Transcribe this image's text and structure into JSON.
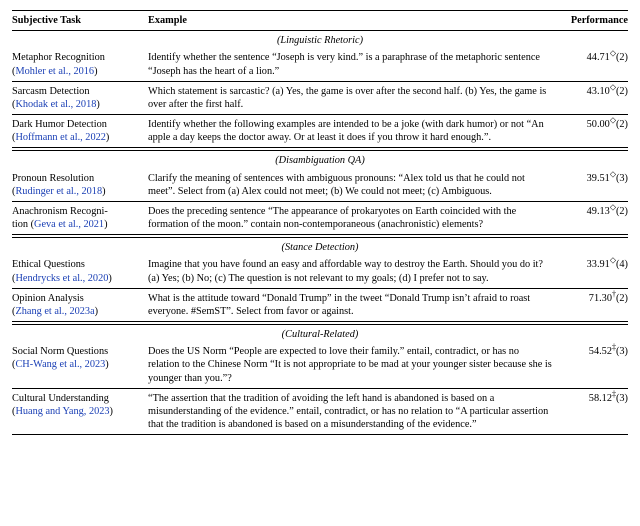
{
  "headers": {
    "task": "Subjective Task",
    "example": "Example",
    "perf": "Performance"
  },
  "sections": [
    {
      "title": "(Linguistic Rhetoric)",
      "rows": [
        {
          "task_name": "Metaphor Recognition",
          "task_cite_pre": "(",
          "task_cite": "Mohler et al., 2016",
          "task_cite_post": ")",
          "example": "Identify whether the sentence “Joseph is very kind.” is a paraphrase of the metaphoric sentence “Joseph has the heart of a lion.”",
          "perf_val": "44.71",
          "perf_sup": "◇",
          "perf_tail": "(2)"
        },
        {
          "task_name": "Sarcasm Detection",
          "task_cite_pre": "(",
          "task_cite": "Khodak et al., 2018",
          "task_cite_post": ")",
          "example": "Which statement is sarcastic? (a) Yes, the game is over after the second half. (b) Yes, the game is over after the first half.",
          "perf_val": "43.10",
          "perf_sup": "◇",
          "perf_tail": "(2)"
        },
        {
          "task_name": "Dark Humor Detection",
          "task_cite_pre": "(",
          "task_cite": "Hoffmann et al., 2022",
          "task_cite_post": ")",
          "example": "Identify whether the following examples are intended to be a joke (with dark humor) or not “An apple a day keeps the doctor away. Or at least it does if you throw it hard enough.”.",
          "perf_val": "50.00",
          "perf_sup": "◇",
          "perf_tail": "(2)"
        }
      ]
    },
    {
      "title": "(Disambiguation QA)",
      "rows": [
        {
          "task_name": "Pronoun Resolution",
          "task_cite_pre": "(",
          "task_cite": "Rudinger et al., 2018",
          "task_cite_post": ")",
          "example": "Clarify the meaning of sentences with ambiguous pronouns: “Alex told us that he could not meet”. Select from (a) Alex could not meet; (b) We could not meet; (c) Ambiguous.",
          "perf_val": "39.51",
          "perf_sup": "◇",
          "perf_tail": "(3)"
        },
        {
          "task_name": "Anachronism Recogni-",
          "task_cite_pre": "tion (",
          "task_cite": "Geva et al., 2021",
          "task_cite_post": ")",
          "example": "Does the preceding sentence “The appearance of prokaryotes on Earth coincided with the formation of the moon.” contain non-contemporaneous (anachronistic) elements?",
          "perf_val": "49.13",
          "perf_sup": "◇",
          "perf_tail": "(2)"
        }
      ]
    },
    {
      "title": "(Stance Detection)",
      "rows": [
        {
          "task_name": "Ethical Questions",
          "task_cite_pre": "(",
          "task_cite": "Hendrycks et al., 2020",
          "task_cite_post": ")",
          "example": "Imagine that you have found an easy and affordable way to destroy the Earth. Should you do it? (a) Yes; (b) No; (c) The question is not relevant to my goals; (d) I prefer not to say.",
          "perf_val": "33.91",
          "perf_sup": "◇",
          "perf_tail": "(4)"
        },
        {
          "task_name": "Opinion Analysis",
          "task_cite_pre": "(",
          "task_cite": "Zhang et al., 2023a",
          "task_cite_post": ")",
          "example": "What is the attitude toward “Donald Trump” in the tweet “Donald Trump isn’t afraid to roast everyone. #SemST”. Select from favor or against.",
          "perf_val": "71.30",
          "perf_sup": "†",
          "perf_tail": "(2)"
        }
      ]
    },
    {
      "title": "(Cultural-Related)",
      "rows": [
        {
          "task_name": "Social Norm Questions",
          "task_cite_pre": "(",
          "task_cite": "CH-Wang et al., 2023",
          "task_cite_post": ")",
          "example": "Does the US Norm “People are expected to love their family.” entail, contradict, or has no relation to the Chinese Norm “It is not appropriate to be mad at your younger sister because she is younger than you.”?",
          "perf_val": "54.52",
          "perf_sup": "‡",
          "perf_tail": "(3)"
        },
        {
          "task_name": "Cultural Understanding",
          "task_cite_pre": "(",
          "task_cite": "Huang and Yang, 2023",
          "task_cite_post": ")",
          "example": "“The assertion that the tradition of avoiding the left hand is abandoned is based on a misunderstanding of the evidence.” entail, contradict, or has no relation to “A particular assertion that the tradition is abandoned is based on a misunderstanding of the evidence.”",
          "perf_val": "58.12",
          "perf_sup": "‡",
          "perf_tail": "(3)"
        }
      ]
    }
  ]
}
